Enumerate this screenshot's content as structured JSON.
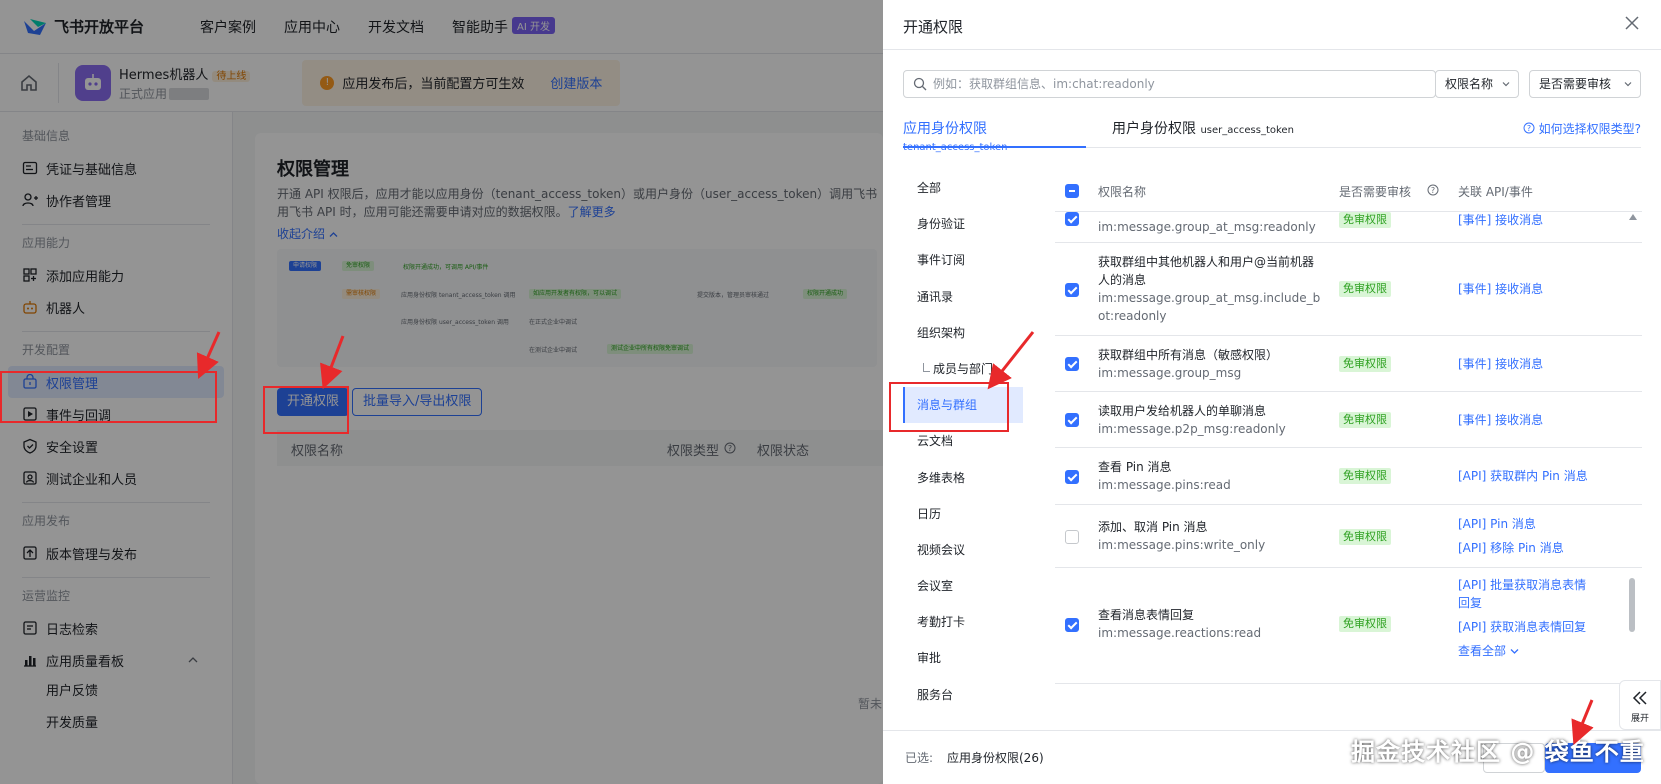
{
  "topnav": {
    "brand": "飞书开放平台",
    "items": [
      "客户案例",
      "应用中心",
      "开发文档",
      "智能助手"
    ],
    "ai_badge": "AI 开发"
  },
  "appbar": {
    "app_name": "Hermes机器人",
    "app_tag": "待上线",
    "app_sub": "正式应用",
    "notice": "应用发布后，当前配置方可生效",
    "notice_link": "创建版本"
  },
  "sidebar": {
    "sections": [
      {
        "title": "基础信息",
        "items": [
          {
            "label": "凭证与基础信息",
            "icon": "id-card-icon"
          },
          {
            "label": "协作者管理",
            "icon": "user-add-icon"
          }
        ]
      },
      {
        "title": "应用能力",
        "items": [
          {
            "label": "添加应用能力",
            "icon": "grid-icon"
          },
          {
            "label": "机器人",
            "icon": "robot-icon"
          }
        ]
      },
      {
        "title": "开发配置",
        "items": [
          {
            "label": "权限管理",
            "icon": "lock-box-icon"
          },
          {
            "label": "事件与回调",
            "icon": "event-icon"
          },
          {
            "label": "安全设置",
            "icon": "shield-icon"
          },
          {
            "label": "测试企业和人员",
            "icon": "test-user-icon"
          }
        ]
      },
      {
        "title": "应用发布",
        "items": [
          {
            "label": "版本管理与发布",
            "icon": "upload-icon"
          }
        ]
      },
      {
        "title": "运营监控",
        "items": [
          {
            "label": "日志检索",
            "icon": "log-icon"
          },
          {
            "label": "应用质量看板",
            "icon": "chart-icon"
          }
        ],
        "sub_items": [
          "用户反馈",
          "开发质量"
        ]
      }
    ]
  },
  "main": {
    "title": "权限管理",
    "desc_1": "开通 API 权限后，应用才能以应用身份（tenant_access_token）或用户身份（user_access_token）调用飞书 API；",
    "desc_2": "用飞书 API 时，应用可能还需要申请对应的数据权限。",
    "learn_more": "了解更多",
    "collapse": "收起介绍",
    "flow": {
      "tag1": "申请权限",
      "l_free": "免审权限",
      "l_free_desc": "权限开通成功，可调用 API/事件",
      "l_review": "需审核权限",
      "l_tenant": "应用身份权限",
      "l_tenant_token": "tenant_access_token 调用",
      "l_user": "应用身份权限",
      "l_user_token": "user_access_token 调用",
      "l_green1": "如应用开发者有权限，可以调试",
      "l_submit": "提交版本，管理员审核通过",
      "l_success": "权限开通成功",
      "l_prod": "在正式企业中调试",
      "l_test": "在测试企业中调试",
      "l_green2": "测试企业中所有权限免审调试"
    },
    "btn_open": "开通权限",
    "btn_batch": "批量导入/导出权限",
    "table_cols": [
      "权限名称",
      "权限类型",
      "权限状态"
    ],
    "empty": "暂未"
  },
  "drawer": {
    "title": "开通权限",
    "search_placeholder": "例如：获取群组信息、im:chat:readonly",
    "select_field": "权限名称",
    "select_review": "是否需要审核",
    "tabs": [
      {
        "label": "应用身份权限",
        "token": "tenant_access_token"
      },
      {
        "label": "用户身份权限",
        "token": "user_access_token"
      }
    ],
    "help": "如何选择权限类型?",
    "categories": [
      "全部",
      "身份验证",
      "事件订阅",
      "通讯录",
      "组织架构",
      "成员与部门",
      "消息与群组",
      "云文档",
      "多维表格",
      "日历",
      "视频会议",
      "会议室",
      "考勤打卡",
      "审批",
      "服务台"
    ],
    "active_category": "消息与群组",
    "table_head": {
      "name": "权限名称",
      "review": "是否需要审核",
      "api": "关联 API/事件"
    },
    "rows": [
      {
        "title": "",
        "code": "im:message.group_at_msg:readonly",
        "checked": true,
        "badge": "免审权限",
        "apis": [
          "[事件] 接收消息"
        ]
      },
      {
        "title": "获取群组中其他机器人和用户@当前机器人的消息",
        "code": "im:message.group_at_msg.include_bot:readonly",
        "checked": true,
        "badge": "免审权限",
        "apis": [
          "[事件] 接收消息"
        ]
      },
      {
        "title": "获取群组中所有消息（敏感权限）",
        "code": "im:message.group_msg",
        "checked": true,
        "badge": "免审权限",
        "apis": [
          "[事件] 接收消息"
        ]
      },
      {
        "title": "读取用户发给机器人的单聊消息",
        "code": "im:message.p2p_msg:readonly",
        "checked": true,
        "badge": "免审权限",
        "apis": [
          "[事件] 接收消息"
        ]
      },
      {
        "title": "查看 Pin 消息",
        "code": "im:message.pins:read",
        "checked": true,
        "badge": "免审权限",
        "apis": [
          "[API] 获取群内 Pin 消息"
        ]
      },
      {
        "title": "添加、取消 Pin 消息",
        "code": "im:message.pins:write_only",
        "checked": false,
        "badge": "免审权限",
        "apis": [
          "[API] Pin 消息",
          "[API] 移除 Pin 消息"
        ]
      },
      {
        "title": "查看消息表情回复",
        "code": "im:message.reactions:read",
        "checked": true,
        "badge": "免审权限",
        "apis": [
          "[API] 批量获取消息表情",
          "回复",
          "[API] 获取消息表情回复"
        ],
        "more": "查看全部"
      }
    ],
    "expand": "展开",
    "footer_label": "已选:",
    "footer_value": "应用身份权限(26)"
  },
  "watermark": "掘金技术社区 @ 袋鱼不重",
  "colors": {
    "primary": "#3370ff",
    "annotation": "#e8292b",
    "free_badge": "#2ea121"
  }
}
